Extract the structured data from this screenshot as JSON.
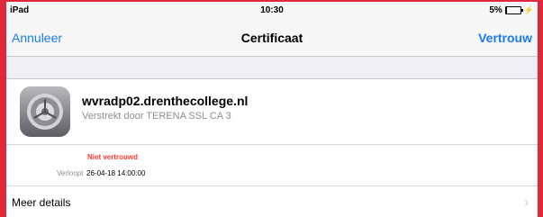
{
  "statusbar": {
    "device": "iPad",
    "time": "10:30",
    "battery": "5%",
    "battery_level": 0.05
  },
  "navbar": {
    "cancel_label": "Annuleer",
    "title": "Certificaat",
    "trust_label": "Vertrouw",
    "accent_color": "#1a7af8"
  },
  "certificate": {
    "icon": "settings-gear-icon",
    "name": "wvradp02.drenthecollege.nl",
    "issuer": "Verstrekt door TERENA SSL CA 3",
    "status": "Niet vertrouwd",
    "status_color": "#ff3b30",
    "expires_label": "Verloopt",
    "expires_value": "26-04-18 14:00:00",
    "details_label": "Meer details",
    "details_icon": "chevron-right-icon"
  }
}
